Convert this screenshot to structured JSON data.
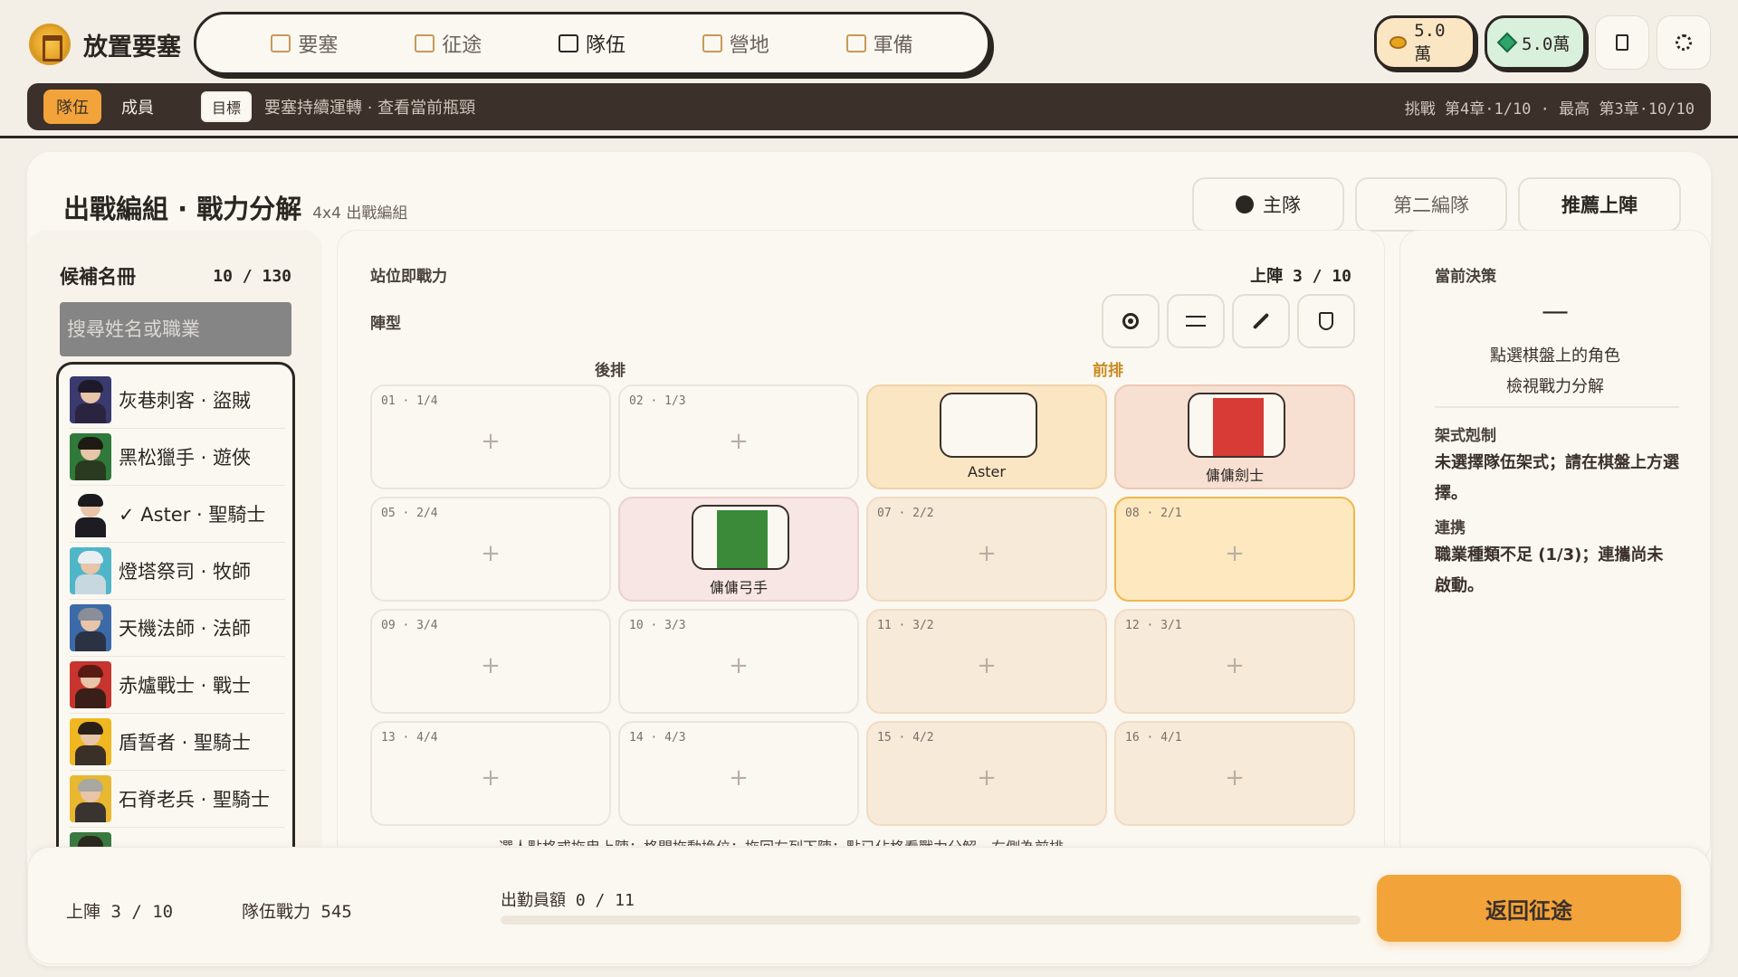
{
  "app": {
    "name": "放置要塞"
  },
  "nav": [
    {
      "label": "要塞",
      "icon": "fortress-icon",
      "active": false
    },
    {
      "label": "征途",
      "icon": "route-icon",
      "active": false
    },
    {
      "label": "隊伍",
      "icon": "team-grid-icon",
      "active": true
    },
    {
      "label": "營地",
      "icon": "camp-icon",
      "active": false
    },
    {
      "label": "軍備",
      "icon": "armory-icon",
      "active": false
    }
  ],
  "resources": {
    "gold": "5.0萬",
    "gem": "5.0萬"
  },
  "subbar": {
    "tabs": [
      "隊伍",
      "成員"
    ],
    "goal_badge": "目標",
    "goal_text": "要塞持續運轉 · 查看當前瓶頸",
    "progress_text": "挑戰 第4章·1/10 · 最高 第3章·10/10"
  },
  "header": {
    "title": "出戰編組 · 戰力分解",
    "subtitle": "4x4 出戰編組",
    "team_main": "主隊",
    "team_second": "第二編隊",
    "recommend": "推薦上陣"
  },
  "candidates": {
    "title": "候補名冊",
    "count": "10 / 130",
    "search_placeholder": "搜尋姓名或職業",
    "items": [
      {
        "name": "灰巷刺客 · 盜賊",
        "colors": [
          "#3a3a6e",
          "#1e1a2a",
          "#2b2440"
        ]
      },
      {
        "name": "黑松獵手 · 遊俠",
        "colors": [
          "#2f7a3a",
          "#1e1a14",
          "#2a3a20"
        ]
      },
      {
        "name": "✓ Aster · 聖騎士",
        "colors": [
          "#fbf8f2",
          "#1a1a1e",
          "#1c1c22"
        ]
      },
      {
        "name": "燈塔祭司 · 牧師",
        "colors": [
          "#4fb6c8",
          "#e8eef2",
          "#c8d8e0"
        ]
      },
      {
        "name": "天機法師 · 法師",
        "colors": [
          "#3c6aa8",
          "#8a8e98",
          "#2a3244"
        ]
      },
      {
        "name": "赤爐戰士 · 戰士",
        "colors": [
          "#c8352e",
          "#5a1a14",
          "#3a1e18"
        ]
      },
      {
        "name": "盾誓者 · 聖騎士",
        "colors": [
          "#f0b820",
          "#2a2016",
          "#3a3028"
        ]
      },
      {
        "name": "石脊老兵 · 聖騎士",
        "colors": [
          "#e8b830",
          "#a8a8a0",
          "#3a3430"
        ]
      },
      {
        "name": "",
        "colors": [
          "#3a7a40",
          "#2a2a20",
          "#2a2a20"
        ]
      }
    ]
  },
  "board": {
    "title": "站位即戰力",
    "formation_label": "陣型",
    "deployed": "上陣 3 / 10",
    "back_row": "後排",
    "front_row": "前排",
    "hint": "選人點格或拖曳上陣；格間拖動換位；拖回左列下陣；點已佔格看戰力分解。右側為前排",
    "tools": [
      "target-icon",
      "wind-icon",
      "sword-icon",
      "shield-icon"
    ],
    "cells": [
      {
        "id": "01 · 1/4",
        "unit": null,
        "style": "empty"
      },
      {
        "id": "02 · 1/3",
        "unit": null,
        "style": "empty"
      },
      {
        "id": "",
        "unit": "Aster",
        "style": "filled-a",
        "colors": [
          "#fbf8f2",
          "#1a1a1e",
          "#1c1c22"
        ]
      },
      {
        "id": "",
        "unit": "傭傭劍士",
        "style": "filled-b",
        "colors": [
          "#d83a36",
          "#5a1a14",
          "#3a1e18"
        ]
      },
      {
        "id": "05 · 2/4",
        "unit": null,
        "style": "empty"
      },
      {
        "id": "",
        "unit": "傭傭弓手",
        "style": "filled-c",
        "colors": [
          "#3a8a3a",
          "#6a4a22",
          "#3a2a18"
        ]
      },
      {
        "id": "07 · 2/2",
        "unit": null,
        "style": "front"
      },
      {
        "id": "08 · 2/1",
        "unit": null,
        "style": "highlight"
      },
      {
        "id": "09 · 3/4",
        "unit": null,
        "style": "empty"
      },
      {
        "id": "10 · 3/3",
        "unit": null,
        "style": "empty"
      },
      {
        "id": "11 · 3/2",
        "unit": null,
        "style": "front"
      },
      {
        "id": "12 · 3/1",
        "unit": null,
        "style": "front"
      },
      {
        "id": "13 · 4/4",
        "unit": null,
        "style": "empty"
      },
      {
        "id": "14 · 4/3",
        "unit": null,
        "style": "empty"
      },
      {
        "id": "15 · 4/2",
        "unit": null,
        "style": "front"
      },
      {
        "id": "16 · 4/1",
        "unit": null,
        "style": "front"
      }
    ]
  },
  "decision": {
    "title": "當前決策",
    "dash": "—",
    "hint_line1": "點選棋盤上的角色",
    "hint_line2": "檢視戰力分解",
    "counter_label": "架式剋制",
    "counter_text": "未選擇隊伍架式；請在棋盤上方選擇。",
    "synergy_label": "連携",
    "synergy_text": "職業種類不足 (1/3)；連攜尚未啟動。"
  },
  "footer": {
    "deployed": "上陣 3 / 10",
    "power": "隊伍戰力 545",
    "quota": "出勤員額 0 / 11",
    "quota_fraction": 0,
    "return_label": "返回征途"
  }
}
